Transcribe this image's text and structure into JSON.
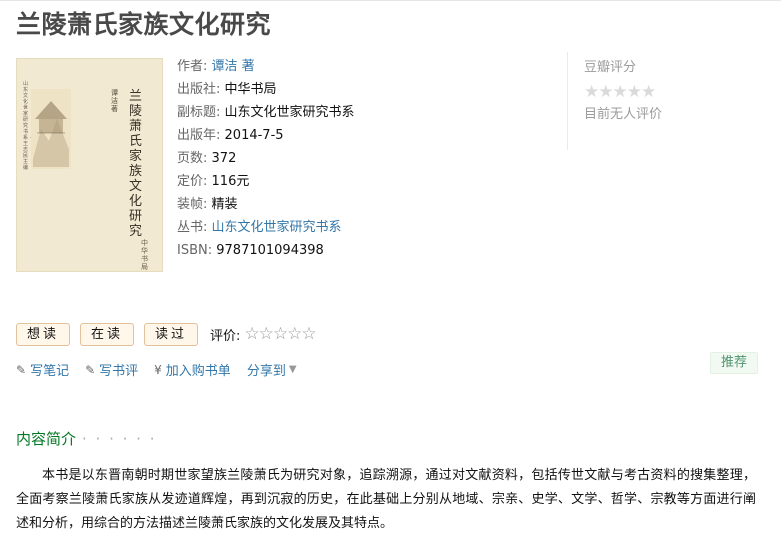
{
  "book": {
    "title": "兰陵萧氏家族文化研究",
    "cover": {
      "title": "兰陵萧氏家族文化研究",
      "author": "谭洁 著",
      "series": "山东文化世家研究书系 · 王志民 主编",
      "publisher": "中华书局"
    },
    "info": [
      {
        "label": "作者:",
        "value": "谭洁 著",
        "is_link": true
      },
      {
        "label": "出版社:",
        "value": "中华书局",
        "is_link": false
      },
      {
        "label": "副标题:",
        "value": "山东文化世家研究书系",
        "is_link": false
      },
      {
        "label": "出版年:",
        "value": "2014-7-5",
        "is_link": false
      },
      {
        "label": "页数:",
        "value": "372",
        "is_link": false
      },
      {
        "label": "定价:",
        "value": "116元",
        "is_link": false
      },
      {
        "label": "装帧:",
        "value": "精装",
        "is_link": false
      },
      {
        "label": "丛书:",
        "value": "山东文化世家研究书系",
        "is_link": true
      },
      {
        "label": "ISBN:",
        "value": "9787101094398",
        "is_link": false
      }
    ]
  },
  "rating": {
    "title": "豆瓣评分",
    "stars": "★★★★★",
    "note": "目前无人评价"
  },
  "actions": {
    "want": "想读",
    "reading": "在读",
    "read": "读过",
    "rate_label": "评价:",
    "rate_stars": "☆☆☆☆☆"
  },
  "links": {
    "note": "写笔记",
    "review": "写书评",
    "cart": "加入购书单",
    "share": "分享到"
  },
  "recommend": "推荐",
  "intro": {
    "title": "内容简介",
    "dots": "· · · · · ·",
    "text": "本书是以东晋南朝时期世家望族兰陵萧氏为研究对象，追踪溯源，通过对文献资料，包括传世文献与考古资料的搜集整理，全面考察兰陵萧氏家族从发迹道辉煌，再到沉寂的历史，在此基础上分别从地域、宗亲、史学、文学、哲学、宗教等方面进行阐述和分析，用综合的方法描述兰陵萧氏家族的文化发展及其特点。"
  },
  "colors": {
    "link": "#3377aa",
    "section_green": "#007722",
    "button_bg": "#fff7ea",
    "button_border": "#e3c19b",
    "recommend_text": "#4f946e"
  }
}
